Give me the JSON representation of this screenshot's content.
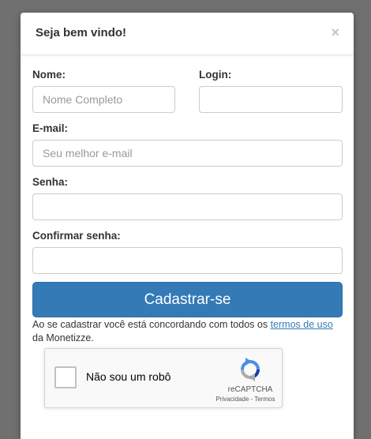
{
  "modal": {
    "title": "Seja bem vindo!",
    "close_symbol": "×"
  },
  "form": {
    "nome": {
      "label": "Nome:",
      "placeholder": "Nome Completo",
      "value": ""
    },
    "login": {
      "label": "Login:",
      "placeholder": "",
      "value": ""
    },
    "email": {
      "label": "E-mail:",
      "placeholder": "Seu melhor e-mail",
      "value": ""
    },
    "senha": {
      "label": "Senha:",
      "placeholder": "",
      "value": ""
    },
    "confirmar": {
      "label": "Confirmar senha:",
      "placeholder": "",
      "value": ""
    },
    "submit_label": "Cadastrar-se",
    "terms_prefix": "Ao se cadastrar você está concordando com todos os ",
    "terms_link": "termos de uso",
    "terms_suffix": " da Monetizze."
  },
  "recaptcha": {
    "checkbox_label": "Não sou um robô",
    "brand": "reCAPTCHA",
    "privacy": "Privacidade",
    "separator": " - ",
    "terms": "Termos",
    "icon": "recaptcha-logo"
  },
  "colors": {
    "primary": "#337ab7",
    "backdrop": "#707070"
  }
}
